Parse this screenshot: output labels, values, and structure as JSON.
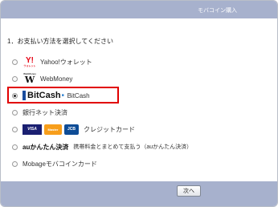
{
  "header": {
    "title": "モバコイン購入"
  },
  "section": {
    "heading": "1．お支払い方法を選択してください"
  },
  "options": [
    {
      "label": "Yahoo!ウォレット",
      "selected": false,
      "logo": "Y!",
      "logo_sub": "ウォレット"
    },
    {
      "label": "WebMoney",
      "selected": false,
      "logo": "W",
      "logo_sub": "WebMoney"
    },
    {
      "label": "BitCash",
      "selected": true,
      "logo": "BitCash",
      "logo_sub": "■"
    },
    {
      "label": "銀行ネット決済",
      "selected": false
    },
    {
      "label": "クレジットカード",
      "selected": false,
      "logos": [
        "VISA",
        "Master",
        "JCB"
      ]
    },
    {
      "label": "携帯料金とまとめて支払う（auかんたん決済）",
      "selected": false,
      "logo": "auかんたん決済"
    },
    {
      "label": "Mobageモバコインカード",
      "selected": false
    }
  ],
  "footer": {
    "next_label": "次へ"
  },
  "colors": {
    "bar": "#a7b1cd",
    "highlight": "#e10000",
    "yahoo_red": "#e60012",
    "visa_blue": "#1a1f71",
    "mc_red": "#eb001b",
    "mc_orange": "#f79e1b",
    "jcb_blue": "#0e4c96"
  }
}
